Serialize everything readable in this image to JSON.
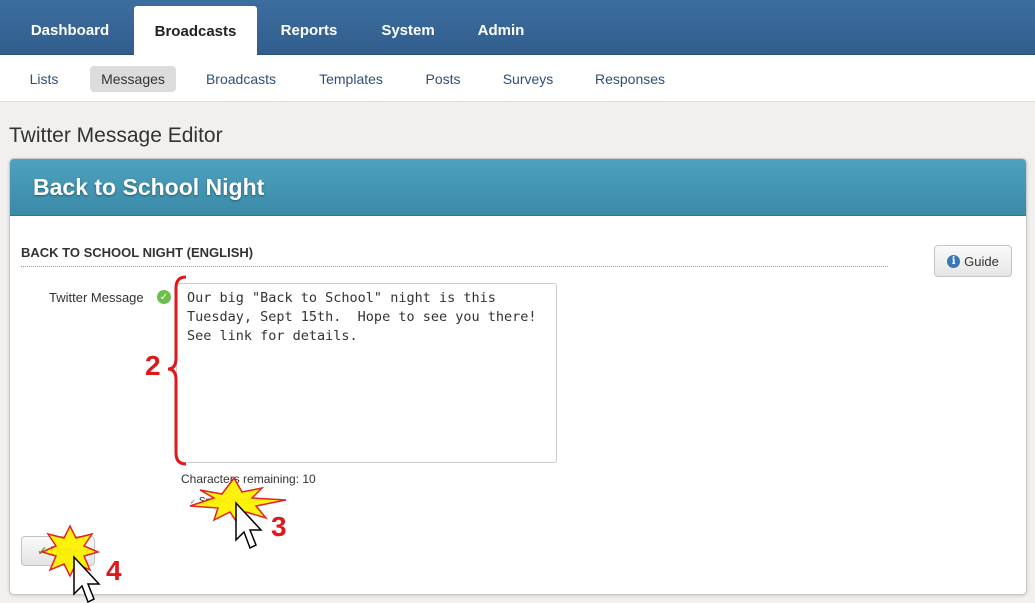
{
  "topnav": {
    "tabs": [
      {
        "label": "Dashboard",
        "active": false
      },
      {
        "label": "Broadcasts",
        "active": true
      },
      {
        "label": "Reports",
        "active": false
      },
      {
        "label": "System",
        "active": false
      },
      {
        "label": "Admin",
        "active": false
      }
    ]
  },
  "subnav": {
    "items": [
      {
        "label": "Lists",
        "active": false
      },
      {
        "label": "Messages",
        "active": true
      },
      {
        "label": "Broadcasts",
        "active": false
      },
      {
        "label": "Templates",
        "active": false
      },
      {
        "label": "Posts",
        "active": false
      },
      {
        "label": "Surveys",
        "active": false
      },
      {
        "label": "Responses",
        "active": false
      }
    ]
  },
  "page": {
    "title": "Twitter Message Editor"
  },
  "panel": {
    "header": "Back to School Night",
    "section_title": "BACK TO SCHOOL NIGHT (ENGLISH)",
    "guide_label": "Guide",
    "field_label": "Twitter Message",
    "message": "Our big \"Back to School\" night is this Tuesday, Sept 15th.  Hope to see you there!  See link for details.",
    "chars_remaining": "Characters remaining: 10",
    "spell_check_label": "Spell Check",
    "done_label": "Done"
  },
  "annotations": {
    "step2": "2",
    "step3": "3",
    "step4": "4",
    "accent_color": "#e0181c",
    "burst_color": "#fff200"
  },
  "colors": {
    "topnav": "#3a6b9c",
    "panel_header": "#4496b4"
  }
}
